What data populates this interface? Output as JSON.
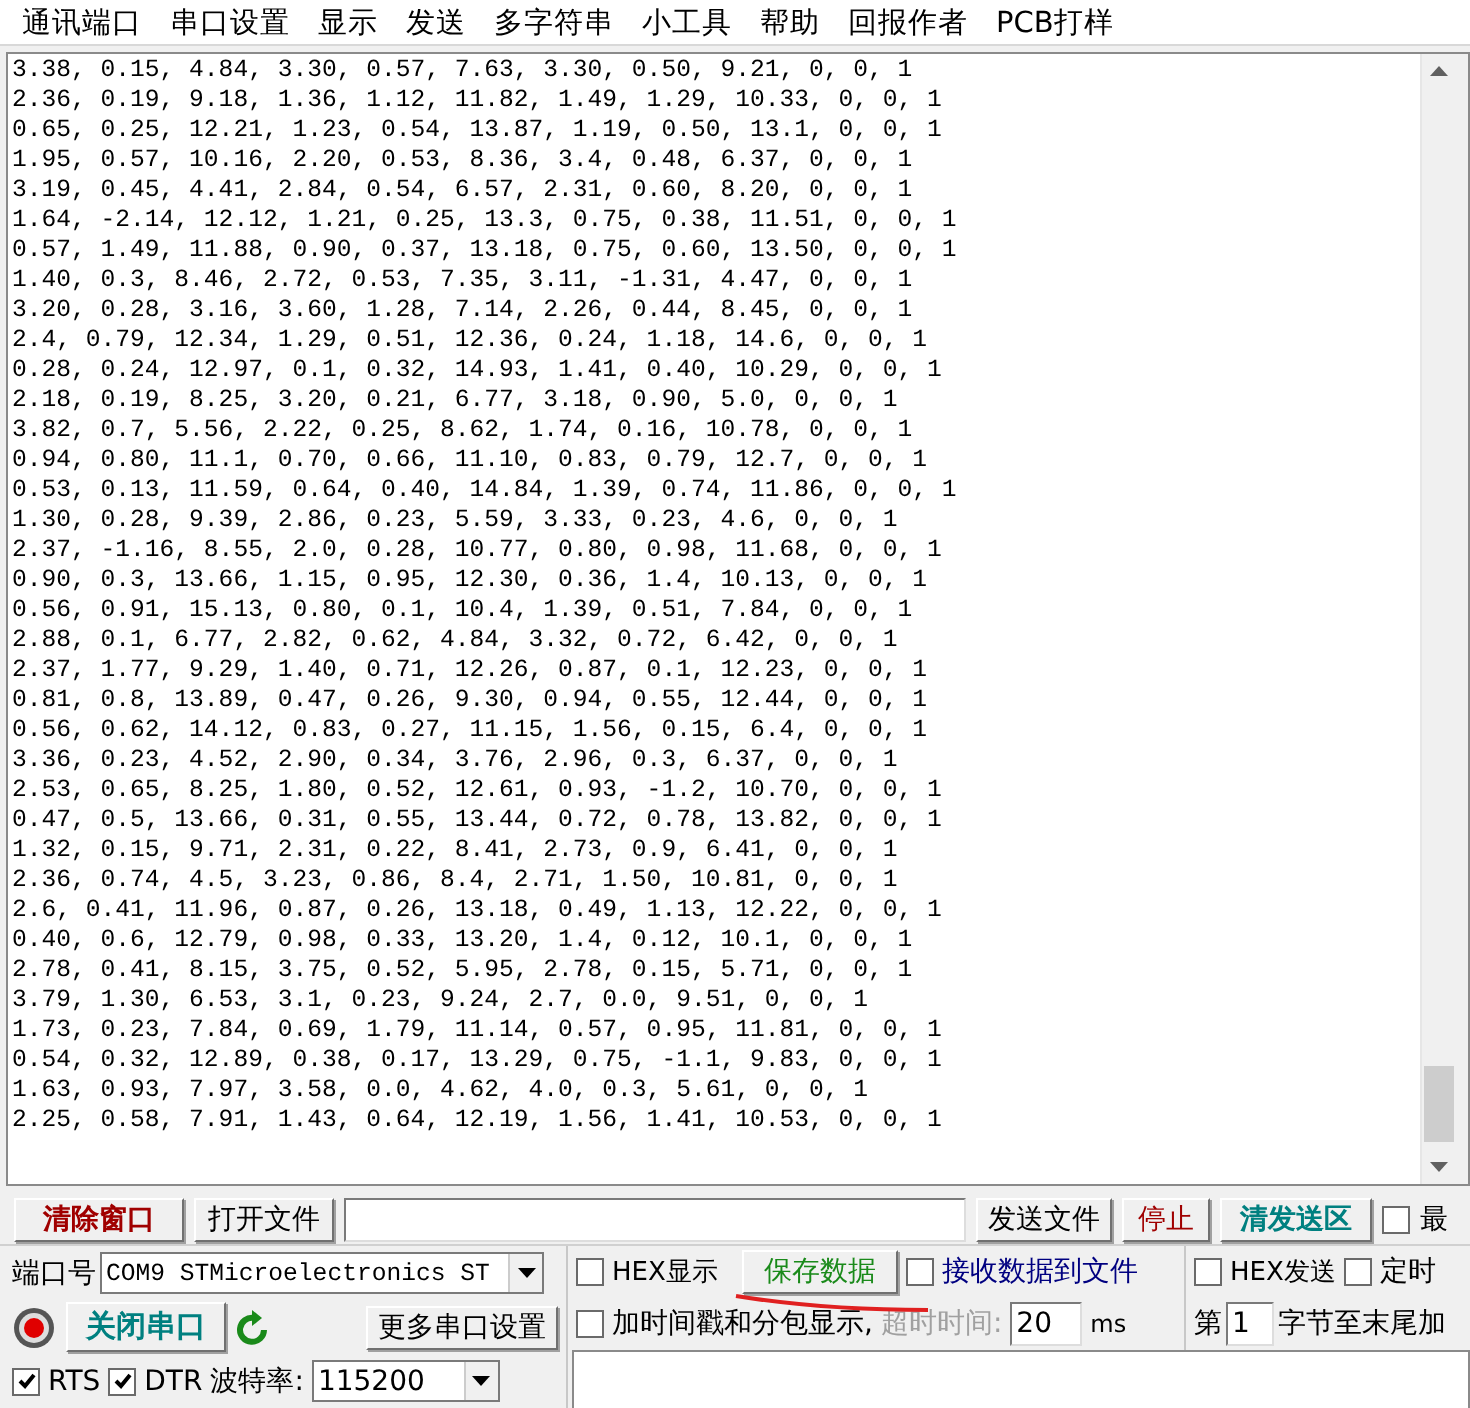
{
  "menu": [
    "通讯端口",
    "串口设置",
    "显示",
    "发送",
    "多字符串",
    "小工具",
    "帮助",
    "回报作者",
    "PCB打样"
  ],
  "receive_lines": [
    "3.38, 0.15, 4.84, 3.30, 0.57, 7.63, 3.30, 0.50, 9.21, 0, 0, 1",
    "2.36, 0.19, 9.18, 1.36, 1.12, 11.82, 1.49, 1.29, 10.33, 0, 0, 1",
    "0.65, 0.25, 12.21, 1.23, 0.54, 13.87, 1.19, 0.50, 13.1, 0, 0, 1",
    "1.95, 0.57, 10.16, 2.20, 0.53, 8.36, 3.4, 0.48, 6.37, 0, 0, 1",
    "3.19, 0.45, 4.41, 2.84, 0.54, 6.57, 2.31, 0.60, 8.20, 0, 0, 1",
    "1.64, -2.14, 12.12, 1.21, 0.25, 13.3, 0.75, 0.38, 11.51, 0, 0, 1",
    "0.57, 1.49, 11.88, 0.90, 0.37, 13.18, 0.75, 0.60, 13.50, 0, 0, 1",
    "1.40, 0.3, 8.46, 2.72, 0.53, 7.35, 3.11, -1.31, 4.47, 0, 0, 1",
    "3.20, 0.28, 3.16, 3.60, 1.28, 7.14, 2.26, 0.44, 8.45, 0, 0, 1",
    "2.4, 0.79, 12.34, 1.29, 0.51, 12.36, 0.24, 1.18, 14.6, 0, 0, 1",
    "0.28, 0.24, 12.97, 0.1, 0.32, 14.93, 1.41, 0.40, 10.29, 0, 0, 1",
    "2.18, 0.19, 8.25, 3.20, 0.21, 6.77, 3.18, 0.90, 5.0, 0, 0, 1",
    "3.82, 0.7, 5.56, 2.22, 0.25, 8.62, 1.74, 0.16, 10.78, 0, 0, 1",
    "0.94, 0.80, 11.1, 0.70, 0.66, 11.10, 0.83, 0.79, 12.7, 0, 0, 1",
    "0.53, 0.13, 11.59, 0.64, 0.40, 14.84, 1.39, 0.74, 11.86, 0, 0, 1",
    "1.30, 0.28, 9.39, 2.86, 0.23, 5.59, 3.33, 0.23, 4.6, 0, 0, 1",
    "2.37, -1.16, 8.55, 2.0, 0.28, 10.77, 0.80, 0.98, 11.68, 0, 0, 1",
    "0.90, 0.3, 13.66, 1.15, 0.95, 12.30, 0.36, 1.4, 10.13, 0, 0, 1",
    "0.56, 0.91, 15.13, 0.80, 0.1, 10.4, 1.39, 0.51, 7.84, 0, 0, 1",
    "2.88, 0.1, 6.77, 2.82, 0.62, 4.84, 3.32, 0.72, 6.42, 0, 0, 1",
    "2.37, 1.77, 9.29, 1.40, 0.71, 12.26, 0.87, 0.1, 12.23, 0, 0, 1",
    "0.81, 0.8, 13.89, 0.47, 0.26, 9.30, 0.94, 0.55, 12.44, 0, 0, 1",
    "0.56, 0.62, 14.12, 0.83, 0.27, 11.15, 1.56, 0.15, 6.4, 0, 0, 1",
    "3.36, 0.23, 4.52, 2.90, 0.34, 3.76, 2.96, 0.3, 6.37, 0, 0, 1",
    "2.53, 0.65, 8.25, 1.80, 0.52, 12.61, 0.93, -1.2, 10.70, 0, 0, 1",
    "0.47, 0.5, 13.66, 0.31, 0.55, 13.44, 0.72, 0.78, 13.82, 0, 0, 1",
    "1.32, 0.15, 9.71, 2.31, 0.22, 8.41, 2.73, 0.9, 6.41, 0, 0, 1",
    "2.36, 0.74, 4.5, 3.23, 0.86, 8.4, 2.71, 1.50, 10.81, 0, 0, 1",
    "2.6, 0.41, 11.96, 0.87, 0.26, 13.18, 0.49, 1.13, 12.22, 0, 0, 1",
    "0.40, 0.6, 12.79, 0.98, 0.33, 13.20, 1.4, 0.12, 10.1, 0, 0, 1",
    "2.78, 0.41, 8.15, 3.75, 0.52, 5.95, 2.78, 0.15, 5.71, 0, 0, 1",
    "3.79, 1.30, 6.53, 3.1, 0.23, 9.24, 2.7, 0.0, 9.51, 0, 0, 1",
    "1.73, 0.23, 7.84, 0.69, 1.79, 11.14, 0.57, 0.95, 11.81, 0, 0, 1",
    "0.54, 0.32, 12.89, 0.38, 0.17, 13.29, 0.75, -1.1, 9.83, 0, 0, 1",
    "1.63, 0.93, 7.97, 3.58, 0.0, 4.62, 4.0, 0.3, 5.61, 0, 0, 1",
    "2.25, 0.58, 7.91, 1.43, 0.64, 12.19, 1.56, 1.41, 10.53, 0, 0, 1"
  ],
  "toolbar": {
    "clear_button": "清除窗口",
    "open_file_button": "打开文件",
    "send_file_button": "发送文件",
    "stop_button": "停止",
    "clear_send_button": "清发送区",
    "topmost": {
      "label": "最",
      "checked": false
    }
  },
  "port": {
    "label": "端口号",
    "value": "COM9 STMicroelectronics ST"
  },
  "hex_display": {
    "label": "HEX显示",
    "checked": false
  },
  "save_button": "保存数据",
  "receive_to_file": {
    "label": "接收数据到文件",
    "checked": false
  },
  "hex_send": {
    "label": "HEX发送",
    "checked": false
  },
  "timed_send": {
    "label": "定时",
    "checked": false
  },
  "port_open": true,
  "close_port_button": "关闭串口",
  "more_settings_button": "更多串口设置",
  "timestamp": {
    "label": "加时间戳和分包显示,",
    "checked": false
  },
  "timeout": {
    "label": "超时时间:",
    "value": "20",
    "unit": "ms",
    "disabled": true
  },
  "append": {
    "prefix": "第",
    "value": "1",
    "suffix": "字节至末尾加"
  },
  "rts": {
    "label": "RTS",
    "checked": true
  },
  "dtr": {
    "label": "DTR",
    "checked": true
  },
  "baud": {
    "label": "波特率:",
    "value": "115200"
  }
}
